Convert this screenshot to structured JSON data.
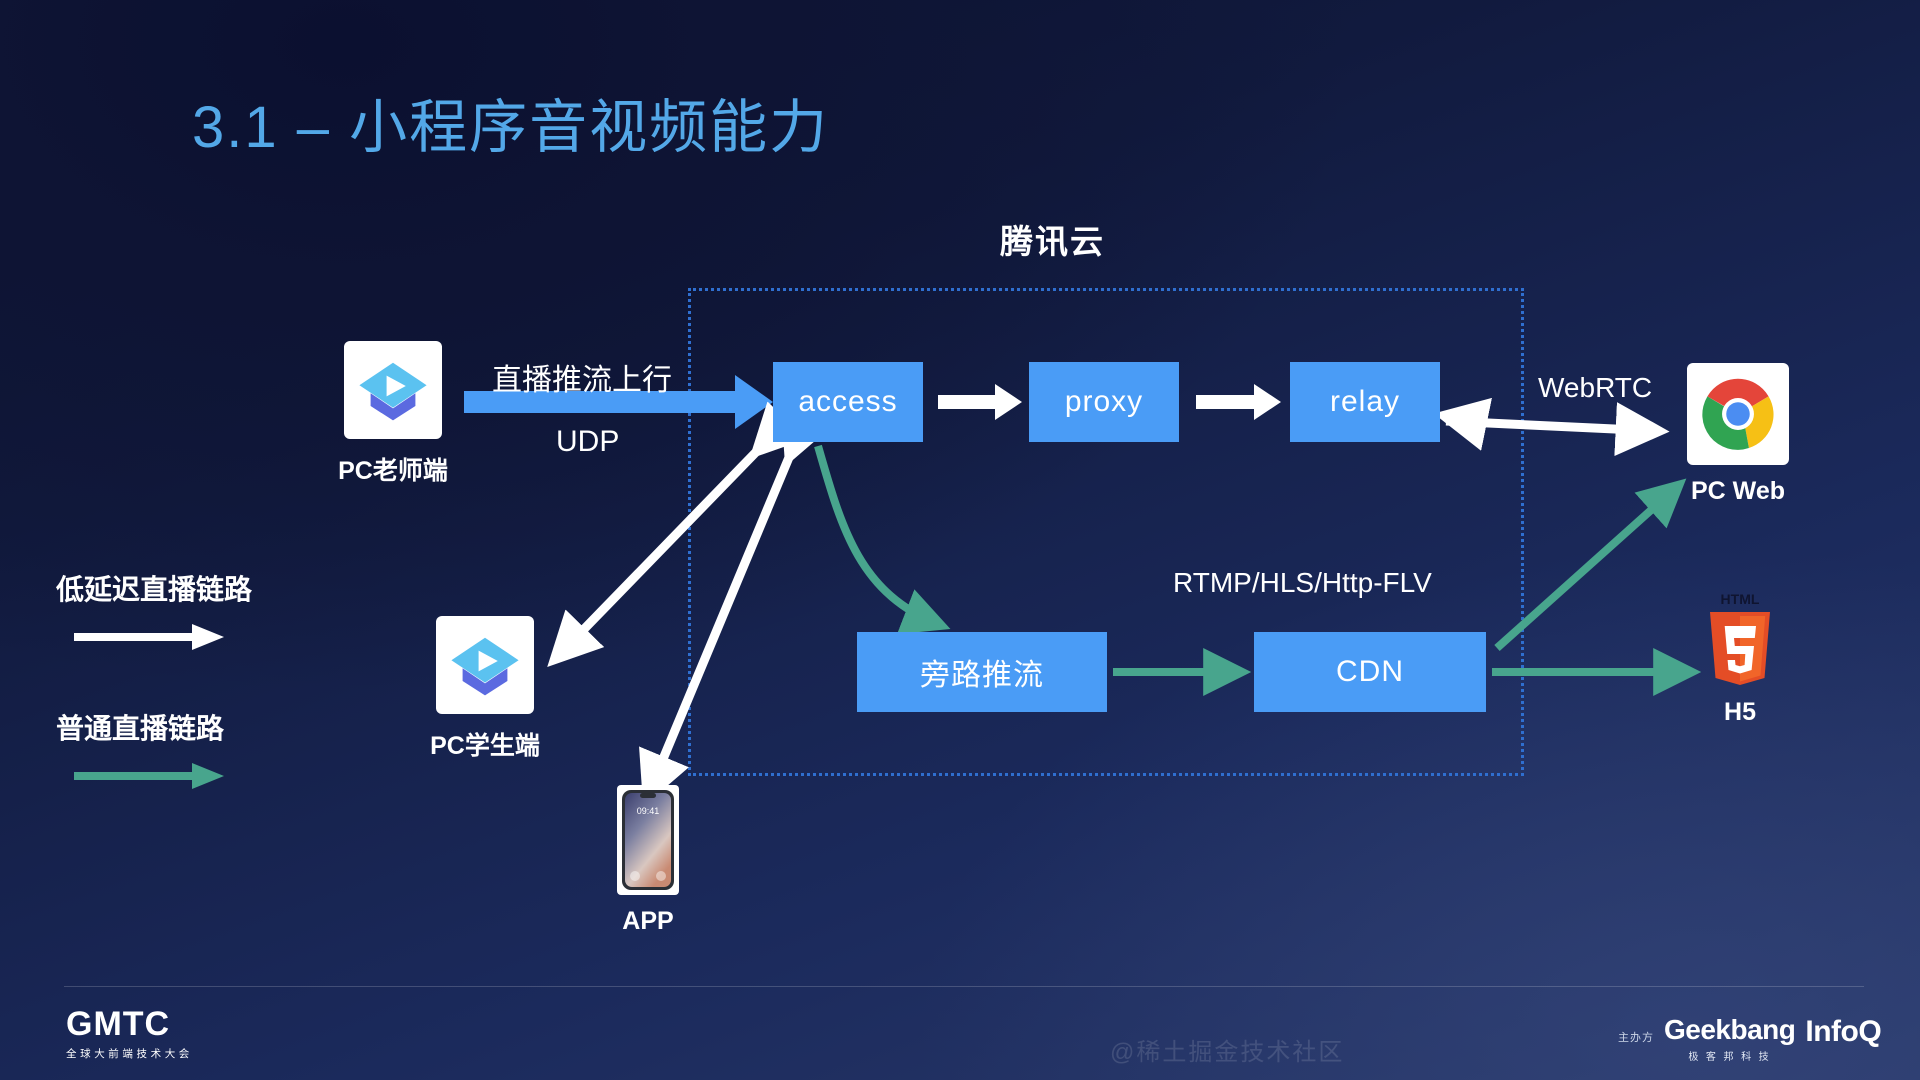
{
  "slide": {
    "title": "3.1 – 小程序音视频能力",
    "title_color": "#53a8e8",
    "background_color": "#16224a"
  },
  "cloud": {
    "label": "腾讯云",
    "border_color": "#2f6fd0"
  },
  "nodes": [
    {
      "id": "access",
      "label": "access",
      "color": "#4a9cf6"
    },
    {
      "id": "proxy",
      "label": "proxy",
      "color": "#4a9cf6"
    },
    {
      "id": "relay",
      "label": "relay",
      "color": "#4a9cf6"
    },
    {
      "id": "bypass",
      "label": "旁路推流",
      "color": "#4a9cf6"
    },
    {
      "id": "cdn",
      "label": "CDN",
      "color": "#4a9cf6"
    }
  ],
  "labels": {
    "push_uplink": "直播推流上行",
    "udp": "UDP",
    "webrtc": "WebRTC",
    "rtmp": "RTMP/HLS/Http-FLV"
  },
  "endpoints": [
    {
      "id": "pc-teacher",
      "caption": "PC老师端",
      "icon": "graduation-play-icon"
    },
    {
      "id": "pc-student",
      "caption": "PC学生端",
      "icon": "graduation-play-icon"
    },
    {
      "id": "app",
      "caption": "APP",
      "icon": "smartphone-icon",
      "screen_time": "09:41"
    },
    {
      "id": "pc-web",
      "caption": "PC Web",
      "icon": "chrome-icon"
    },
    {
      "id": "h5",
      "caption": "H5",
      "icon": "html5-icon",
      "icon_text": "HTML"
    }
  ],
  "legend": [
    {
      "label": "低延迟直播链路",
      "color": "#ffffff"
    },
    {
      "label": "普通直播链路",
      "color": "#48a58d"
    }
  ],
  "footer": {
    "logo_main": "GMTC",
    "logo_sub": "全球大前端技术大会",
    "host_label": "主办方",
    "sponsor_main": "Geekbang",
    "sponsor_sub": "极 客 邦 科 技",
    "sponsor_second": "InfoQ",
    "watermark": "@稀土掘金技术社区"
  }
}
